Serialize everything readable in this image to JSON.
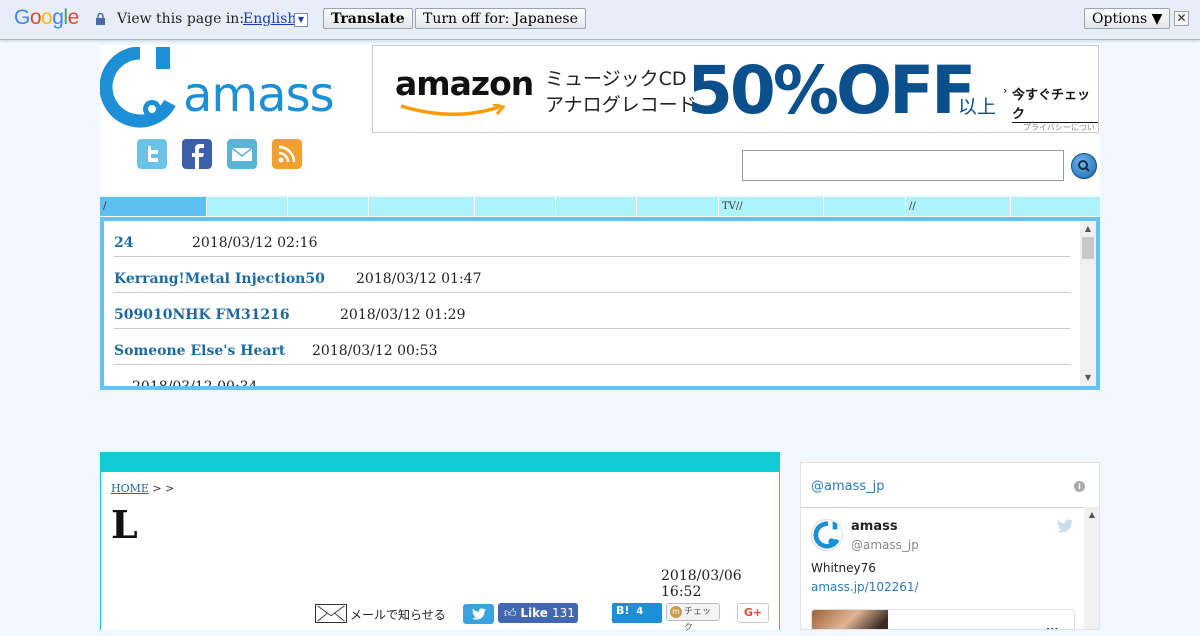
{
  "translate_bar": {
    "logo": "Google",
    "view_text": "View this page in:",
    "language": "English",
    "translate_label": "Translate",
    "turn_off_label": "Turn off for: Japanese",
    "options_label": "Options ▼",
    "close_label": "✕"
  },
  "header": {
    "logo_text": "amass",
    "banner": {
      "brand": "amazon",
      "line1": "ミュージックCD",
      "line2": "アナログレコード",
      "discount": "50%OFF",
      "suffix": "以上",
      "cta": "今すぐチェック",
      "privacy": "プライバシーについて"
    },
    "search": {
      "placeholder": ""
    }
  },
  "nav": {
    "tabs": [
      {
        "label": "/",
        "active": true
      },
      {
        "label": ""
      },
      {
        "label": ""
      },
      {
        "label": ""
      },
      {
        "label": ""
      },
      {
        "label": ""
      },
      {
        "label": ""
      },
      {
        "label": "TV//"
      },
      {
        "label": ""
      },
      {
        "label": "//"
      },
      {
        "label": ""
      }
    ]
  },
  "ticker": {
    "items": [
      {
        "title": "24",
        "date": "2018/03/12 02:16"
      },
      {
        "title": "Kerrang!Metal Injection50",
        "date": "2018/03/12 01:47"
      },
      {
        "title": "509010NHK FM31216",
        "date": "2018/03/12 01:29"
      },
      {
        "title": "Someone Else's Heart",
        "date": "2018/03/12 00:53"
      },
      {
        "title": "",
        "date": "2018/03/12 00:34"
      }
    ]
  },
  "article": {
    "breadcrumb_home": "HOME",
    "breadcrumb_sep": ">  >",
    "title": "L",
    "date": "2018/03/06 16:52",
    "share": {
      "mail_label": "メールで知らせる",
      "fb_like": "Like",
      "fb_count": "131",
      "hatena_label": "B!",
      "hatena_count": "4",
      "mixi_label": "チェック",
      "gplus_label": "G+"
    }
  },
  "twitter": {
    "header_handle": "@amass_jp",
    "tweet": {
      "name": "amass",
      "handle": "@amass_jp",
      "text": "Whitney76",
      "link": "amass.jp/102261/",
      "more": "..."
    }
  },
  "colors": {
    "accent_cyan": "#11ccd2",
    "nav_bg": "#aef3fb",
    "nav_active": "#5bbff0",
    "ticker_border": "#62c4f3",
    "link": "#1b6aa0",
    "amass_blue": "#1d8fd6"
  }
}
